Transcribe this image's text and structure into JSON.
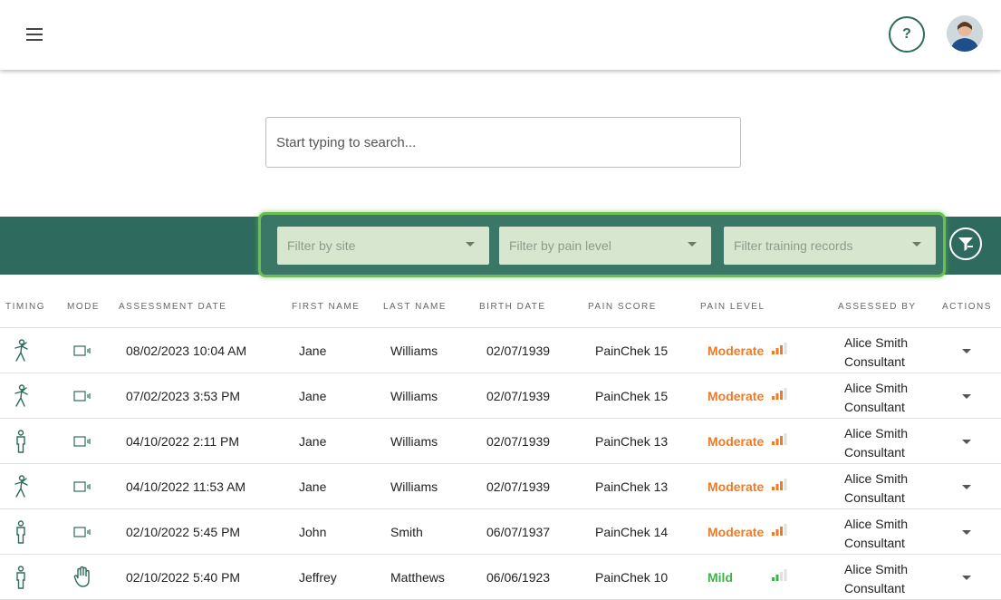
{
  "header": {
    "menu_icon": "hamburger-menu-icon",
    "help_label": "?",
    "avatar_icon": "user-avatar"
  },
  "search": {
    "placeholder": "Start typing to search...",
    "value": ""
  },
  "filters": {
    "site": "Filter by site",
    "pain_level": "Filter by pain level",
    "training": "Filter training records",
    "clear_icon": "filter-clear-icon"
  },
  "colors": {
    "brand": "#2e6b5e",
    "highlight": "#6bbf4e",
    "moderate": "#f07a23",
    "mild": "#3bb54a"
  },
  "table": {
    "columns": [
      "TIMING",
      "MODE",
      "ASSESSMENT DATE",
      "FIRST NAME",
      "LAST NAME",
      "BIRTH DATE",
      "PAIN SCORE",
      "PAIN LEVEL",
      "ASSESSED BY",
      "ACTIONS"
    ],
    "rows": [
      {
        "timing": "movement-icon",
        "mode": "camera-icon",
        "date": "08/02/2023 10:04 AM",
        "first": "Jane",
        "last": "Williams",
        "birth": "02/07/1939",
        "score": "PainChek 15",
        "level": "Moderate",
        "bars": 3,
        "assessor": "Alice Smith",
        "role": "Consultant"
      },
      {
        "timing": "movement-icon",
        "mode": "camera-icon",
        "date": "07/02/2023 3:53 PM",
        "first": "Jane",
        "last": "Williams",
        "birth": "02/07/1939",
        "score": "PainChek 15",
        "level": "Moderate",
        "bars": 3,
        "assessor": "Alice Smith",
        "role": "Consultant"
      },
      {
        "timing": "rest-icon",
        "mode": "camera-icon",
        "date": "04/10/2022 2:11 PM",
        "first": "Jane",
        "last": "Williams",
        "birth": "02/07/1939",
        "score": "PainChek 13",
        "level": "Moderate",
        "bars": 3,
        "assessor": "Alice Smith",
        "role": "Consultant"
      },
      {
        "timing": "movement-icon",
        "mode": "camera-icon",
        "date": "04/10/2022 11:53 AM",
        "first": "Jane",
        "last": "Williams",
        "birth": "02/07/1939",
        "score": "PainChek 13",
        "level": "Moderate",
        "bars": 3,
        "assessor": "Alice Smith",
        "role": "Consultant"
      },
      {
        "timing": "rest-icon",
        "mode": "camera-icon",
        "date": "02/10/2022 5:45 PM",
        "first": "John",
        "last": "Smith",
        "birth": "06/07/1937",
        "score": "PainChek 14",
        "level": "Moderate",
        "bars": 3,
        "assessor": "Alice Smith",
        "role": "Consultant"
      },
      {
        "timing": "rest-icon",
        "mode": "hand-icon",
        "date": "02/10/2022 5:40 PM",
        "first": "Jeffrey",
        "last": "Matthews",
        "birth": "06/06/1923",
        "score": "PainChek 10",
        "level": "Mild",
        "bars": 2,
        "assessor": "Alice Smith",
        "role": "Consultant"
      }
    ]
  }
}
